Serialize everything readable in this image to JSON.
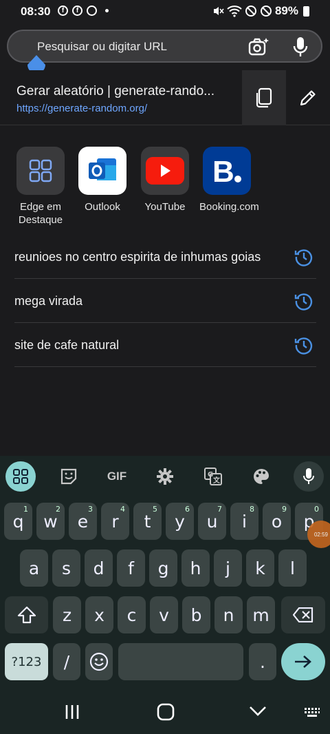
{
  "status": {
    "time": "08:30",
    "battery": "89%"
  },
  "address_bar": {
    "placeholder": "Pesquisar ou digitar URL"
  },
  "top_suggestion": {
    "title": "Gerar aleatório | generate-rando...",
    "url": "https://generate-random.org/"
  },
  "top_sites": [
    {
      "label": "Edge em Destaque",
      "icon": "grid-icon"
    },
    {
      "label": "Outlook",
      "icon": "outlook-icon"
    },
    {
      "label": "YouTube",
      "icon": "youtube-icon"
    },
    {
      "label": "Booking.com",
      "icon": "booking-icon"
    }
  ],
  "history": [
    {
      "text": "reunioes no centro espirita de inhumas goias"
    },
    {
      "text": "mega virada"
    },
    {
      "text": "site de cafe natural"
    }
  ],
  "keyboard": {
    "toolbar": {
      "gif": "GIF"
    },
    "row1": [
      {
        "k": "q",
        "h": "1"
      },
      {
        "k": "w",
        "h": "2"
      },
      {
        "k": "e",
        "h": "3"
      },
      {
        "k": "r",
        "h": "4"
      },
      {
        "k": "t",
        "h": "5"
      },
      {
        "k": "y",
        "h": "6"
      },
      {
        "k": "u",
        "h": "7"
      },
      {
        "k": "i",
        "h": "8"
      },
      {
        "k": "o",
        "h": "9"
      },
      {
        "k": "p",
        "h": "0"
      }
    ],
    "row2": [
      "a",
      "s",
      "d",
      "f",
      "g",
      "h",
      "j",
      "k",
      "l"
    ],
    "row3": [
      "z",
      "x",
      "c",
      "v",
      "b",
      "n",
      "m"
    ],
    "symbols_label": "?123",
    "slash": "/",
    "period": ".",
    "bubble_text": "02:59"
  },
  "colors": {
    "accent": "#8ad3d1",
    "link": "#6ea6ff",
    "history_icon": "#4a90e2"
  }
}
